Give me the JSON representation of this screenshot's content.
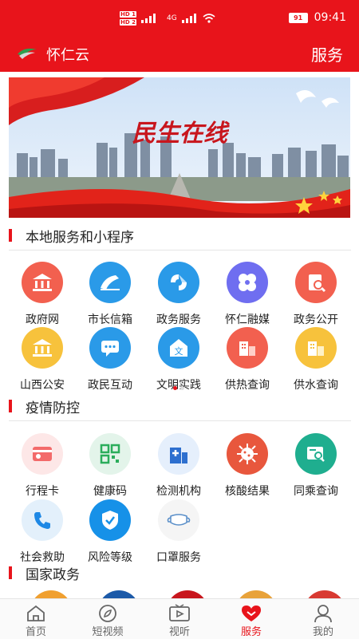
{
  "status_bar": {
    "time": "09:41",
    "battery": "91",
    "network": "4G"
  },
  "header": {
    "app_name": "怀仁云",
    "page_title": "服务"
  },
  "banner": {
    "title": "民生在线"
  },
  "sections": {
    "local": {
      "title": "本地服务和小程序"
    },
    "epidemic": {
      "title": "疫情防控"
    },
    "national": {
      "title": "国家政务"
    }
  },
  "local_items": [
    {
      "label": "政府网",
      "icon": "government-building-icon",
      "color": "#f2604f"
    },
    {
      "label": "市长信箱",
      "icon": "mailbox-icon",
      "color": "#2a9ae8"
    },
    {
      "label": "政务服务",
      "icon": "government-service-icon",
      "color": "#2a9ae8"
    },
    {
      "label": "怀仁融媒",
      "icon": "media-icon",
      "color": "#6f6ef0"
    },
    {
      "label": "政务公开",
      "icon": "public-affairs-icon",
      "color": "#f2604f"
    },
    {
      "label": "山西公安",
      "icon": "police-icon",
      "color": "#f7c23c"
    },
    {
      "label": "政民互动",
      "icon": "chat-icon",
      "color": "#2a9ae8"
    },
    {
      "label": "文明实践",
      "icon": "civilization-icon",
      "color": "#2a9ae8"
    },
    {
      "label": "供热查询",
      "icon": "heating-icon",
      "color": "#f2604f"
    },
    {
      "label": "供水查询",
      "icon": "water-icon",
      "color": "#f7c23c"
    }
  ],
  "epidemic_items": [
    {
      "label": "行程卡",
      "icon": "travel-card-icon",
      "color": "#fde7e7"
    },
    {
      "label": "健康码",
      "icon": "qr-code-icon",
      "color": "#e3f4ea"
    },
    {
      "label": "检测机构",
      "icon": "testing-site-icon",
      "color": "#e5effc"
    },
    {
      "label": "核酸结果",
      "icon": "virus-icon",
      "color": "#e8573d"
    },
    {
      "label": "同乘查询",
      "icon": "same-trip-icon",
      "color": "#1fae8f"
    },
    {
      "label": "社会救助",
      "icon": "phone-icon",
      "color": "#e3f0fb"
    },
    {
      "label": "风险等级",
      "icon": "shield-icon",
      "color": "#1691e8"
    },
    {
      "label": "口罩服务",
      "icon": "mask-icon",
      "color": "#f5f5f5"
    }
  ],
  "bottom_nav": [
    {
      "label": "首页",
      "icon": "home-icon"
    },
    {
      "label": "短视频",
      "icon": "compass-icon"
    },
    {
      "label": "视听",
      "icon": "tv-icon"
    },
    {
      "label": "服务",
      "icon": "heart-icon"
    },
    {
      "label": "我的",
      "icon": "user-icon"
    }
  ]
}
